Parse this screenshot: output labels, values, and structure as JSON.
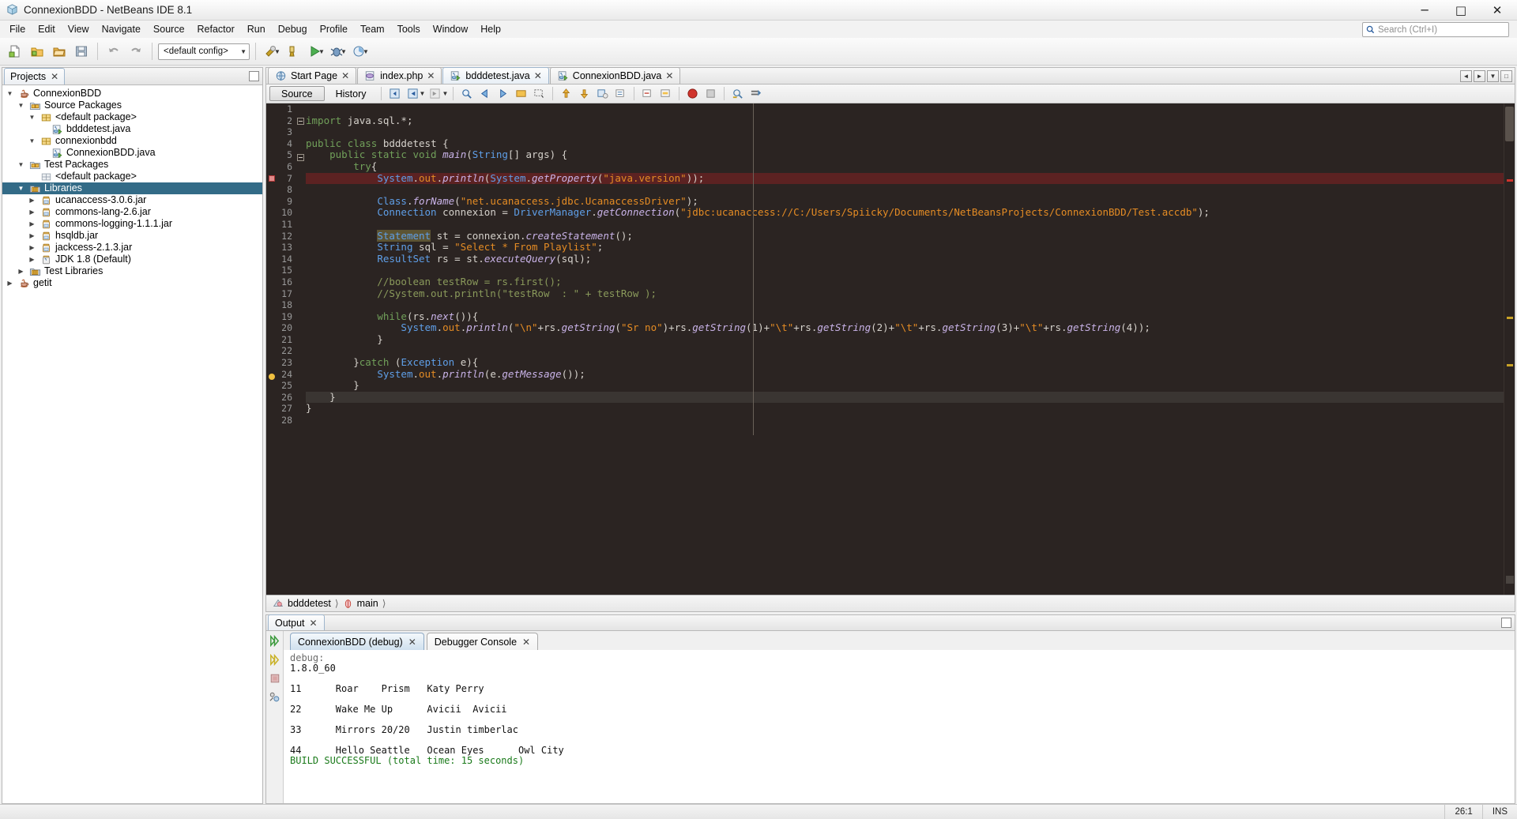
{
  "window": {
    "title": "ConnexionBDD - NetBeans IDE 8.1",
    "app_icon": "cube-icon",
    "minimize_label": "─",
    "maximize_label": "□",
    "close_label": "✕"
  },
  "menubar": {
    "items": [
      {
        "label": "File"
      },
      {
        "label": "Edit"
      },
      {
        "label": "View"
      },
      {
        "label": "Navigate"
      },
      {
        "label": "Source"
      },
      {
        "label": "Refactor"
      },
      {
        "label": "Run"
      },
      {
        "label": "Debug"
      },
      {
        "label": "Profile"
      },
      {
        "label": "Team"
      },
      {
        "label": "Tools"
      },
      {
        "label": "Window"
      },
      {
        "label": "Help"
      }
    ],
    "search": {
      "placeholder": "Search (Ctrl+I)",
      "icon": "search-icon"
    }
  },
  "toolbar": {
    "config_selector": {
      "value": "<default config>",
      "icon": "chevron-down-icon"
    },
    "buttons": [
      {
        "name": "new-file-icon"
      },
      {
        "name": "new-project-icon"
      },
      {
        "name": "open-project-icon"
      },
      {
        "name": "save-all-icon"
      },
      {
        "name": "undo-icon"
      },
      {
        "name": "redo-icon"
      },
      {
        "name": "build-project-icon"
      },
      {
        "name": "clean-build-icon"
      },
      {
        "name": "run-project-icon"
      },
      {
        "name": "debug-project-icon"
      },
      {
        "name": "profile-project-icon"
      }
    ]
  },
  "projects_panel": {
    "tab": {
      "label": "Projects",
      "close": "✕"
    },
    "minimize_icon": "minimize-icon",
    "tree": [
      {
        "indent": 0,
        "twist": "▼",
        "icon": "java-project-icon",
        "label": "ConnexionBDD",
        "selected": false
      },
      {
        "indent": 1,
        "twist": "▼",
        "icon": "package-folder-icon",
        "label": "Source Packages",
        "selected": false
      },
      {
        "indent": 2,
        "twist": "▼",
        "icon": "package-icon",
        "label": "<default package>",
        "selected": false
      },
      {
        "indent": 3,
        "twist": "",
        "icon": "java-file-icon",
        "label": "bdddetest.java",
        "selected": false
      },
      {
        "indent": 2,
        "twist": "▼",
        "icon": "package-icon",
        "label": "connexionbdd",
        "selected": false
      },
      {
        "indent": 3,
        "twist": "",
        "icon": "java-file-icon",
        "label": "ConnexionBDD.java",
        "selected": false
      },
      {
        "indent": 1,
        "twist": "▼",
        "icon": "package-folder-icon",
        "label": "Test Packages",
        "selected": false
      },
      {
        "indent": 2,
        "twist": "",
        "icon": "package-empty-icon",
        "label": "<default package>",
        "selected": false
      },
      {
        "indent": 1,
        "twist": "▼",
        "icon": "libraries-icon",
        "label": "Libraries",
        "selected": true
      },
      {
        "indent": 2,
        "twist": "▶",
        "icon": "jar-icon",
        "label": "ucanaccess-3.0.6.jar",
        "selected": false
      },
      {
        "indent": 2,
        "twist": "▶",
        "icon": "jar-icon",
        "label": "commons-lang-2.6.jar",
        "selected": false
      },
      {
        "indent": 2,
        "twist": "▶",
        "icon": "jar-icon",
        "label": "commons-logging-1.1.1.jar",
        "selected": false
      },
      {
        "indent": 2,
        "twist": "▶",
        "icon": "jar-icon",
        "label": "hsqldb.jar",
        "selected": false
      },
      {
        "indent": 2,
        "twist": "▶",
        "icon": "jar-icon",
        "label": "jackcess-2.1.3.jar",
        "selected": false
      },
      {
        "indent": 2,
        "twist": "▶",
        "icon": "jdk-icon",
        "label": "JDK 1.8 (Default)",
        "selected": false
      },
      {
        "indent": 1,
        "twist": "▶",
        "icon": "libraries-icon",
        "label": "Test Libraries",
        "selected": false
      },
      {
        "indent": 0,
        "twist": "▶",
        "icon": "java-project-icon",
        "label": "getit",
        "selected": false
      }
    ]
  },
  "editor": {
    "tabs": [
      {
        "label": "Start Page",
        "icon": "start-page-icon",
        "close": "✕",
        "active": false
      },
      {
        "label": "index.php",
        "icon": "php-file-icon",
        "close": "✕",
        "active": false
      },
      {
        "label": "bdddetest.java",
        "icon": "java-file-icon",
        "close": "✕",
        "active": true
      },
      {
        "label": "ConnexionBDD.java",
        "icon": "java-file-icon",
        "close": "✕",
        "active": false
      }
    ],
    "tab_controls": [
      {
        "name": "scroll-tabs-left-icon",
        "glyph": "◀"
      },
      {
        "name": "scroll-tabs-right-icon",
        "glyph": "▶"
      },
      {
        "name": "tab-list-icon",
        "glyph": "▼"
      },
      {
        "name": "maximize-editor-icon",
        "glyph": "□"
      }
    ],
    "view_buttons": {
      "source": "Source",
      "history": "History"
    },
    "toolbar_icons": [
      "last-edit-icon",
      "back-icon",
      "forward-icon",
      "find-selection-icon",
      "previous-bookmark-icon",
      "next-bookmark-icon",
      "toggle-bookmark-icon",
      "rectangular-selection-icon",
      "shift-left-icon",
      "shift-right-icon",
      "start-macro-icon",
      "comment-icon",
      "uncomment-icon",
      "toggle-highlight-icon",
      "stop-icon",
      "pause-icon",
      "inspect-icon",
      "run-to-cursor-icon"
    ],
    "breadcrumb": [
      {
        "label": "bdddetest",
        "icon": "class-icon"
      },
      {
        "label": "main",
        "icon": "method-icon"
      }
    ],
    "code_lines": [
      {
        "n": 1,
        "text": "",
        "state": "normal"
      },
      {
        "n": 2,
        "text": "import java.sql.*;",
        "state": "normal"
      },
      {
        "n": 3,
        "text": "",
        "state": "normal"
      },
      {
        "n": 4,
        "text": "public class bdddetest {",
        "state": "normal"
      },
      {
        "n": 5,
        "text": "    public static void main(String[] args) {",
        "state": "normal"
      },
      {
        "n": 6,
        "text": "        try{",
        "state": "normal"
      },
      {
        "n": 7,
        "text": "            System.out.println(System.getProperty(\"java.version\"));",
        "state": "breakpoint"
      },
      {
        "n": 8,
        "text": "",
        "state": "normal"
      },
      {
        "n": 9,
        "text": "            Class.forName(\"net.ucanaccess.jdbc.UcanaccessDriver\");",
        "state": "normal"
      },
      {
        "n": 10,
        "text": "            Connection connexion = DriverManager.getConnection(\"jdbc:ucanaccess://C:/Users/Spiicky/Documents/NetBeansProjects/ConnexionBDD/Test.accdb\");",
        "state": "normal"
      },
      {
        "n": 11,
        "text": "",
        "state": "normal"
      },
      {
        "n": 12,
        "text": "            Statement st = connexion.createStatement();",
        "state": "normal"
      },
      {
        "n": 13,
        "text": "            String sql = \"Select * From Playlist\";",
        "state": "normal"
      },
      {
        "n": 14,
        "text": "            ResultSet rs = st.executeQuery(sql);",
        "state": "normal"
      },
      {
        "n": 15,
        "text": "",
        "state": "normal"
      },
      {
        "n": 16,
        "text": "            //boolean testRow = rs.first();",
        "state": "normal"
      },
      {
        "n": 17,
        "text": "            //System.out.println(\"testRow  : \" + testRow );",
        "state": "normal"
      },
      {
        "n": 18,
        "text": "",
        "state": "normal"
      },
      {
        "n": 19,
        "text": "            while(rs.next()){",
        "state": "normal"
      },
      {
        "n": 20,
        "text": "                System.out.println(\"\\n\"+rs.getString(\"Sr no\")+rs.getString(1)+\"\\t\"+rs.getString(2)+\"\\t\"+rs.getString(3)+\"\\t\"+rs.getString(4));",
        "state": "normal"
      },
      {
        "n": 21,
        "text": "            }",
        "state": "normal"
      },
      {
        "n": 22,
        "text": "",
        "state": "normal"
      },
      {
        "n": 23,
        "text": "        }catch (Exception e){",
        "state": "normal"
      },
      {
        "n": 24,
        "text": "            System.out.println(e.getMessage());",
        "state": "hint"
      },
      {
        "n": 25,
        "text": "        }",
        "state": "normal"
      },
      {
        "n": 26,
        "text": "    }",
        "state": "current"
      },
      {
        "n": 27,
        "text": "}",
        "state": "normal"
      },
      {
        "n": 28,
        "text": "",
        "state": "normal"
      }
    ]
  },
  "output": {
    "tab": {
      "label": "Output",
      "close": "✕"
    },
    "maximize_icon": "maximize-icon",
    "sidebar_icons": [
      "rerun-icon",
      "rerun-debug-icon",
      "stop-icon",
      "settings-icon"
    ],
    "subtabs": [
      {
        "label": "ConnexionBDD (debug)",
        "close": "✕",
        "active": true
      },
      {
        "label": "Debugger Console",
        "close": "✕",
        "active": false
      }
    ],
    "console_lines": [
      {
        "text": "debug:",
        "style": "gray"
      },
      {
        "text": "1.8.0_60",
        "style": "normal"
      },
      {
        "text": "",
        "style": "normal"
      },
      {
        "text": "11      Roar    Prism   Katy Perry",
        "style": "normal"
      },
      {
        "text": "",
        "style": "normal"
      },
      {
        "text": "22      Wake Me Up      Avicii  Avicii",
        "style": "normal"
      },
      {
        "text": "",
        "style": "normal"
      },
      {
        "text": "33      Mirrors 20/20   Justin timberlac",
        "style": "normal"
      },
      {
        "text": "",
        "style": "normal"
      },
      {
        "text": "44      Hello Seattle   Ocean Eyes      Owl City",
        "style": "normal"
      },
      {
        "text": "BUILD SUCCESSFUL (total time: 15 seconds)",
        "style": "green"
      }
    ]
  },
  "statusbar": {
    "caret_position": "26:1",
    "insert_mode": "INS"
  },
  "colors": {
    "selection_blue": "#336b87",
    "editor_bg": "#2b2422",
    "error_line": "#5c2222",
    "build_success": "#1a7a1a"
  }
}
